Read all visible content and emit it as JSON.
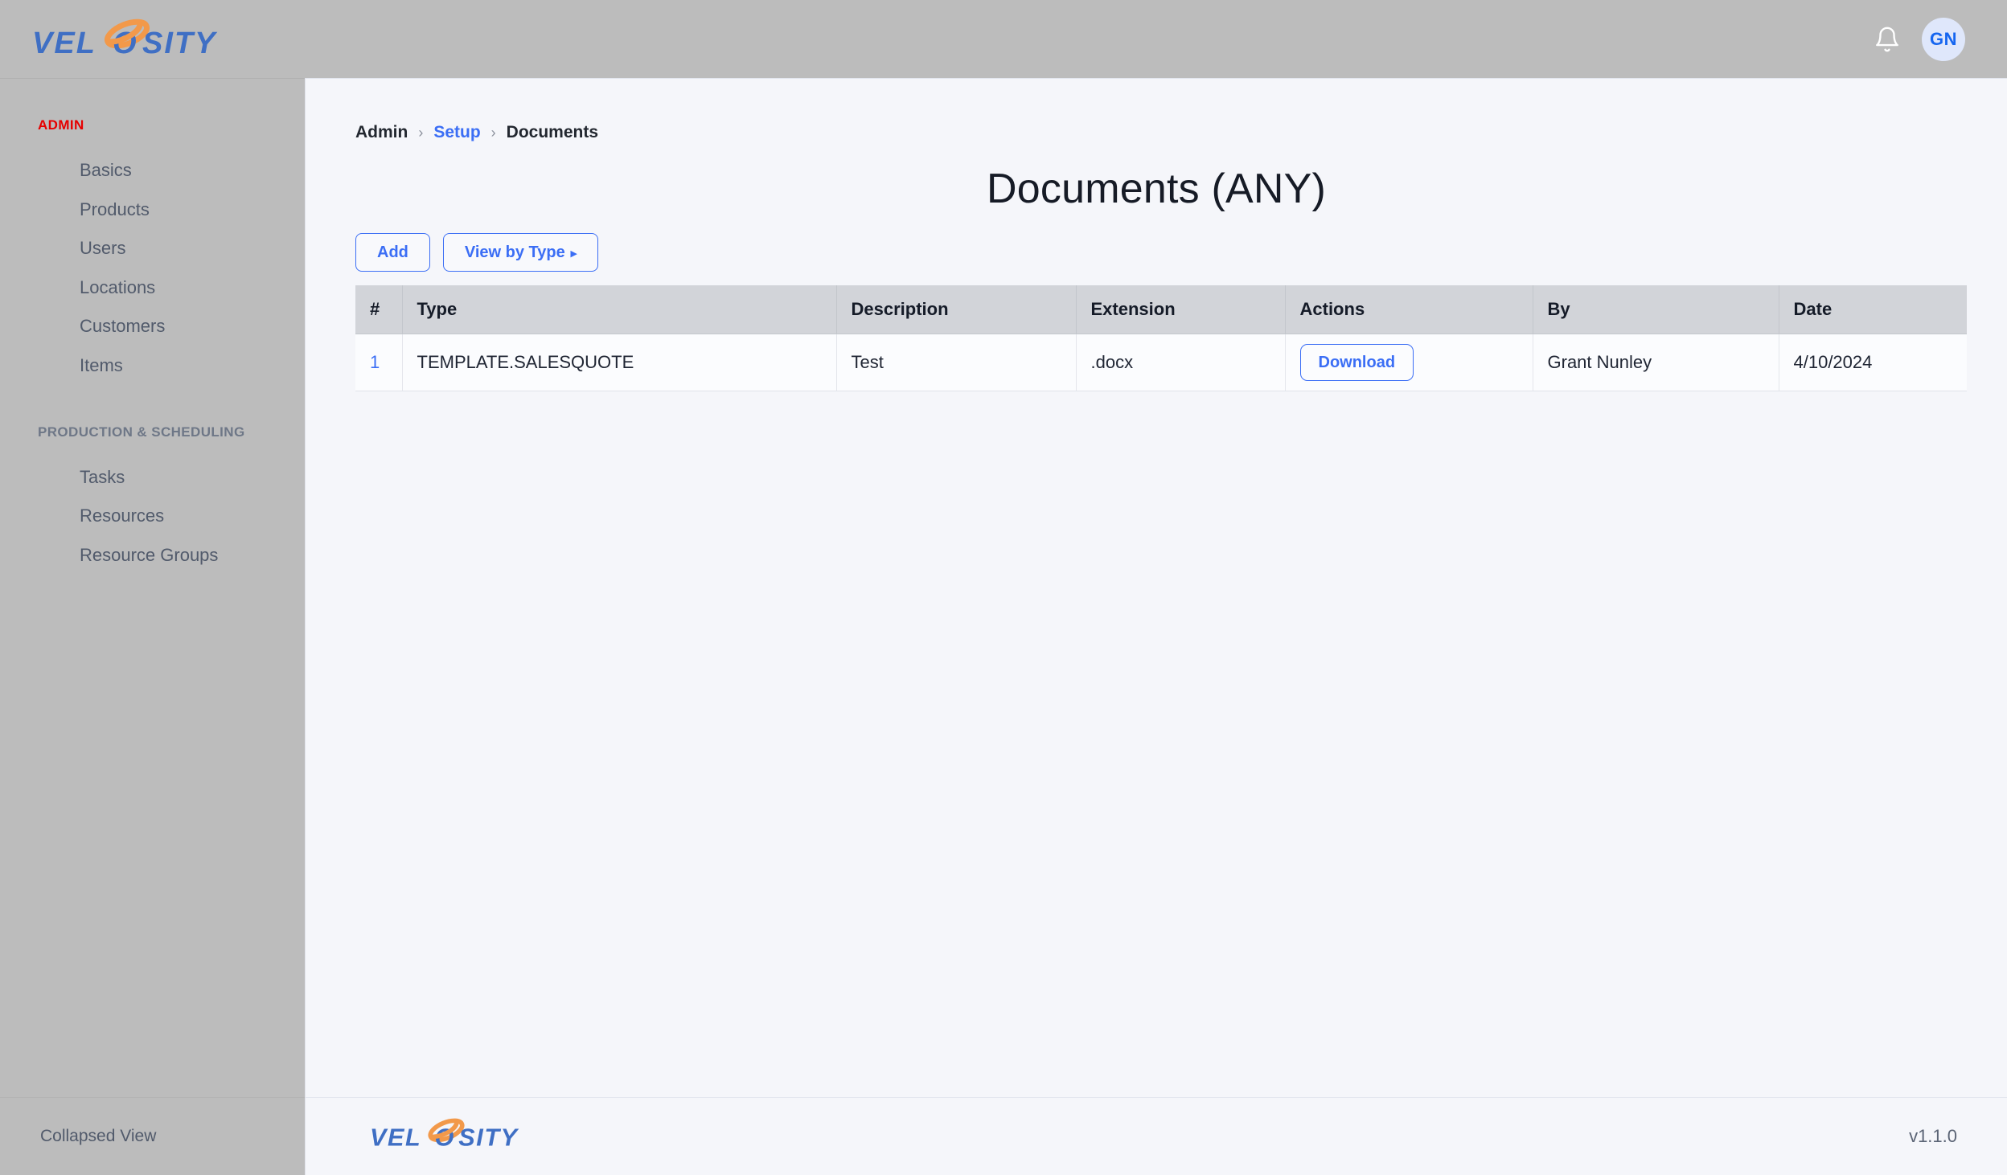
{
  "brand": {
    "name": "VELOSITY",
    "logo_text_part1": "VEL",
    "logo_text_part2": "SITY",
    "logo_o": "O",
    "colors": {
      "logo_blue": "#3f6fc4",
      "logo_orange": "#f2994a",
      "accent_blue": "#3b6ef5",
      "admin_red": "#e60000",
      "chrome_gray": "#bcbcbc",
      "content_bg": "#f5f6fa",
      "table_header_bg": "#d2d4d9"
    }
  },
  "topbar": {
    "notifications_icon": "bell-icon",
    "avatar_initials": "GN"
  },
  "sidebar": {
    "groups": [
      {
        "label": "ADMIN",
        "items": [
          {
            "label": "Basics"
          },
          {
            "label": "Products"
          },
          {
            "label": "Users"
          },
          {
            "label": "Locations"
          },
          {
            "label": "Customers"
          },
          {
            "label": "Items"
          }
        ]
      },
      {
        "label": "PRODUCTION & SCHEDULING",
        "items": [
          {
            "label": "Tasks"
          },
          {
            "label": "Resources"
          },
          {
            "label": "Resource Groups"
          }
        ]
      }
    ],
    "footer_label": "Collapsed View"
  },
  "breadcrumb": {
    "items": [
      {
        "label": "Admin",
        "is_link": false
      },
      {
        "label": "Setup",
        "is_link": true
      },
      {
        "label": "Documents",
        "is_link": false
      }
    ],
    "separator": "›"
  },
  "page": {
    "title": "Documents (ANY)"
  },
  "toolbar": {
    "add_label": "Add",
    "view_by_type_label": "View by Type",
    "view_by_type_caret": "▸"
  },
  "table": {
    "columns": [
      "#",
      "Type",
      "Description",
      "Extension",
      "Actions",
      "By",
      "Date"
    ],
    "rows": [
      {
        "index": "1",
        "type": "TEMPLATE.SALESQUOTE",
        "description": "Test",
        "extension": ".docx",
        "action_label": "Download",
        "by": "Grant Nunley",
        "date": "4/10/2024"
      }
    ]
  },
  "footer": {
    "version": "v1.1.0"
  }
}
